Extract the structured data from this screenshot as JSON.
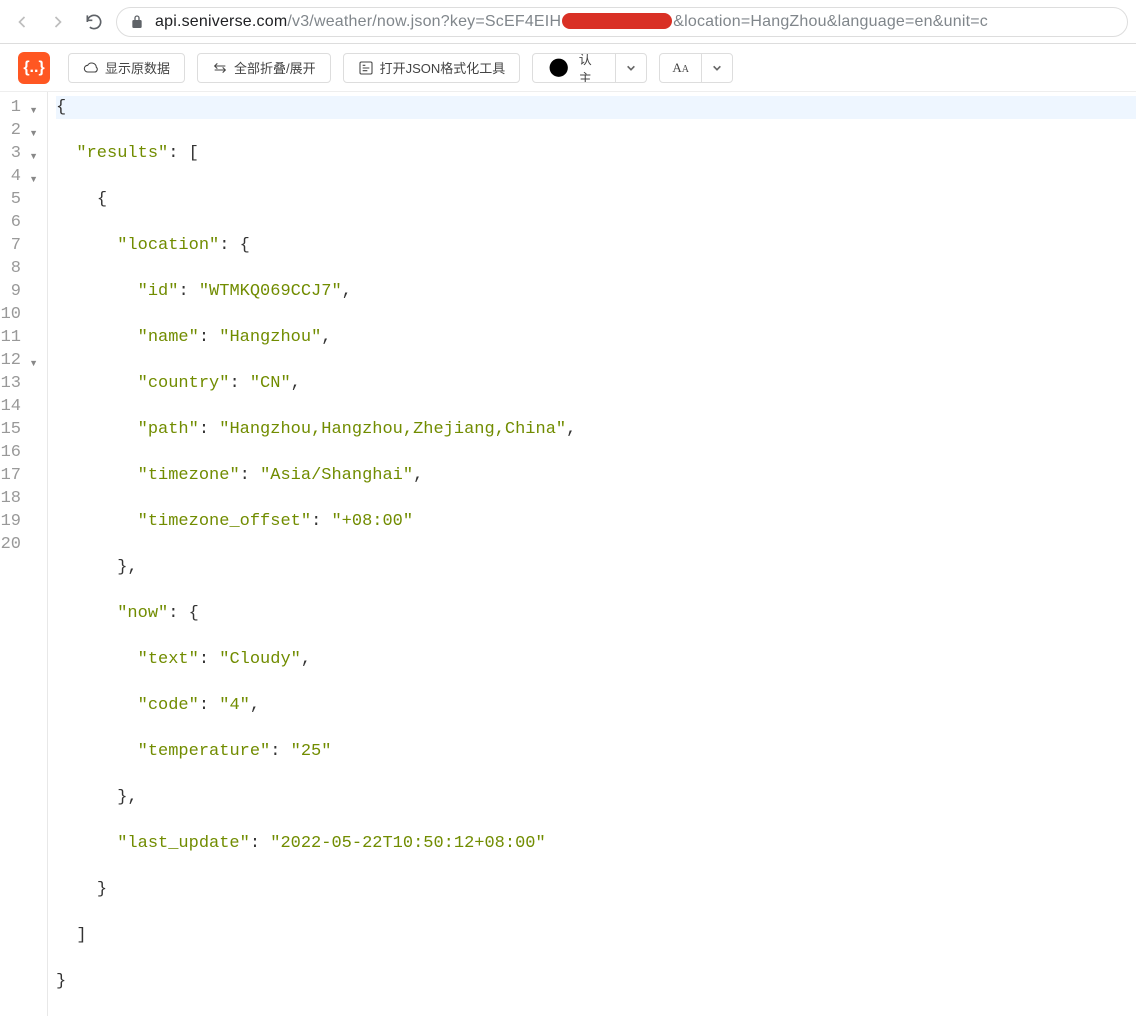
{
  "url": {
    "host": "api.seniverse.com",
    "path": "/v3/weather/now.json?key=ScEF4EIH",
    "suffix": "&location=HangZhou&language=en&unit=c"
  },
  "toolbar": {
    "show_raw": "显示原数据",
    "toggle_all": "全部折叠/展开",
    "open_formatter": "打开JSON格式化工具",
    "default_theme": "默认主题",
    "font_size": "AA"
  },
  "gutter_lines": 20,
  "fold_lines": [
    1,
    2,
    3,
    4,
    12
  ],
  "json_body": {
    "results": [
      {
        "location": {
          "id": "WTMKQ069CCJ7",
          "name": "Hangzhou",
          "country": "CN",
          "path": "Hangzhou,Hangzhou,Zhejiang,China",
          "timezone": "Asia/Shanghai",
          "timezone_offset": "+08:00"
        },
        "now": {
          "text": "Cloudy",
          "code": "4",
          "temperature": "25"
        },
        "last_update": "2022-05-22T10:50:12+08:00"
      }
    ]
  }
}
